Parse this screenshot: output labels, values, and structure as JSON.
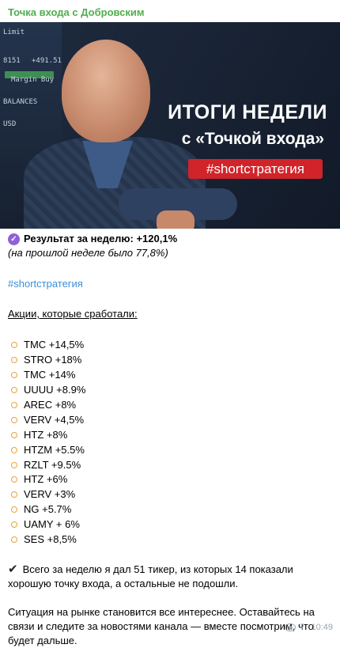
{
  "channel": {
    "name": "Точка входа с Добровским"
  },
  "banner": {
    "title_line1": "ИТОГИ НЕДЕЛИ",
    "title_line2": "с «Точкой входа»",
    "hashtag": "#shortстратегия",
    "screen_labels": [
      "Limit",
      "8151",
      "Margin Buy",
      "BALANCES",
      "USD",
      "+491.51"
    ],
    "colors": {
      "tag": "#d1242a",
      "accent_green": "#4fae4e"
    }
  },
  "post": {
    "result_label": "Результат за неделю: +120,1%",
    "previous_note": "(на прошлой  неделе было 77,8%)",
    "hashtag": "#shortстратегия",
    "stocks_heading": "Акции, которые сработали:",
    "stocks": [
      "TMC +14,5%",
      "STRO +18%",
      "TMC +14%",
      "UUUU +8.9%",
      "AREC +8%",
      "VERV +4,5%",
      "HTZ +8%",
      "HTZM +5.5%",
      "RZLT +9.5%",
      "HTZ +6%",
      "VERV +3%",
      "NG +5.7%",
      "UAMY + 6%",
      "SES +8,5%"
    ],
    "summary": "Всего за неделю я дал 51 тикер, из которых 14 показали хорошую точку входа, а остальные не подошли.",
    "closing": "Ситуация на рынке становится все интереснее.  Оставайтесь на связи и следите за новостями канала — вместе посмотрим, что будет дальше."
  },
  "meta": {
    "views": "7",
    "time": "10:49"
  }
}
